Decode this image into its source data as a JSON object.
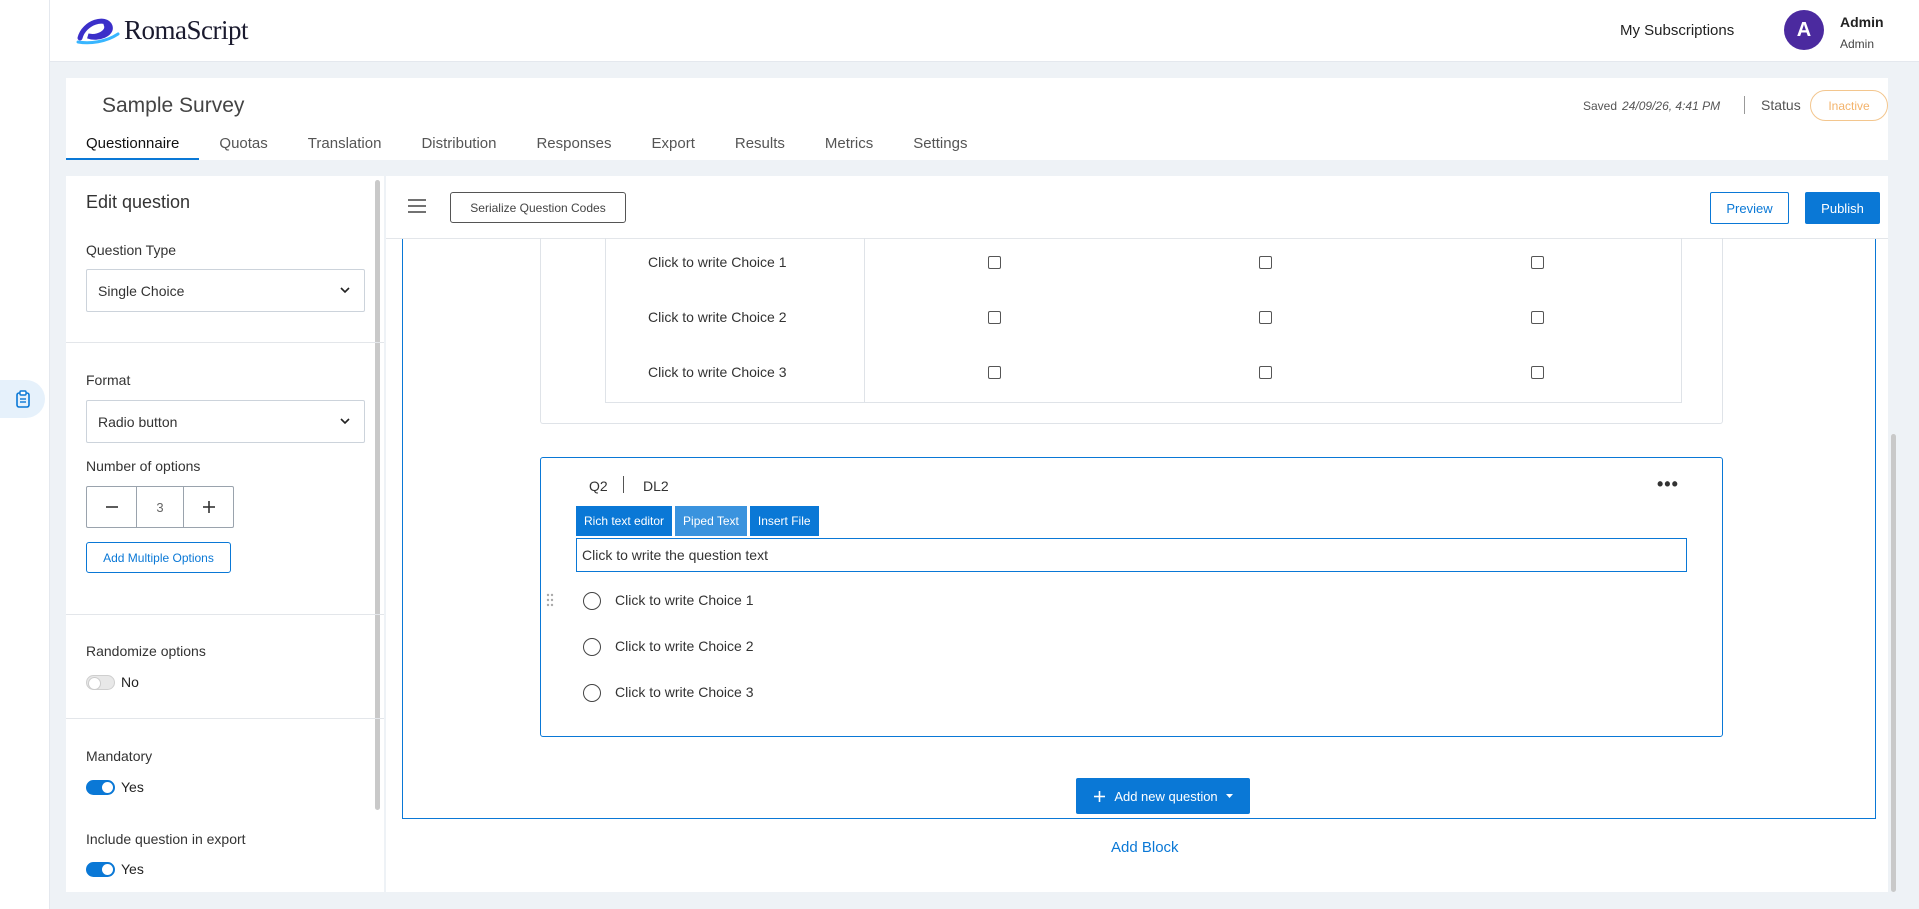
{
  "app": {
    "logo_text": "RomaScript"
  },
  "topbar": {
    "my_subscriptions": "My Subscriptions",
    "avatar_letter": "A",
    "user_name": "Admin",
    "user_role": "Admin"
  },
  "survey": {
    "title": "Sample Survey",
    "saved_label": "Saved",
    "saved_time": "24/09/26, 4:41 PM",
    "status_label": "Status",
    "status_value": "Inactive",
    "tabs": [
      "Questionnaire",
      "Quotas",
      "Translation",
      "Distribution",
      "Responses",
      "Export",
      "Results",
      "Metrics",
      "Settings"
    ]
  },
  "edit_panel": {
    "title": "Edit question",
    "question_type_label": "Question Type",
    "question_type_value": "Single Choice",
    "format_label": "Format",
    "format_value": "Radio button",
    "num_options_label": "Number of options",
    "num_options_value": "3",
    "add_multiple_label": "Add Multiple Options",
    "randomize_label": "Randomize options",
    "randomize_value": "No",
    "mandatory_label": "Mandatory",
    "mandatory_value": "Yes",
    "include_export_label": "Include question in export",
    "include_export_value": "Yes"
  },
  "toolbar": {
    "serialize_label": "Serialize Question Codes",
    "preview_label": "Preview",
    "publish_label": "Publish"
  },
  "q1": {
    "rows": [
      "Click to write Choice 1",
      "Click to write Choice 2",
      "Click to write Choice 3"
    ]
  },
  "q2": {
    "code": "Q2",
    "dl": "DL2",
    "rt_buttons": [
      "Rich text editor",
      "Piped Text",
      "Insert File"
    ],
    "question_text": "Click to write the question text",
    "choices": [
      "Click to write Choice 1",
      "Click to write Choice 2",
      "Click to write Choice 3"
    ]
  },
  "actions": {
    "add_new_question": "Add new question",
    "add_block": "Add Block"
  },
  "colors": {
    "accent": "#0a78d6",
    "brand_avatar": "#4b2a9f",
    "inactive_badge": "#f3b36b"
  }
}
